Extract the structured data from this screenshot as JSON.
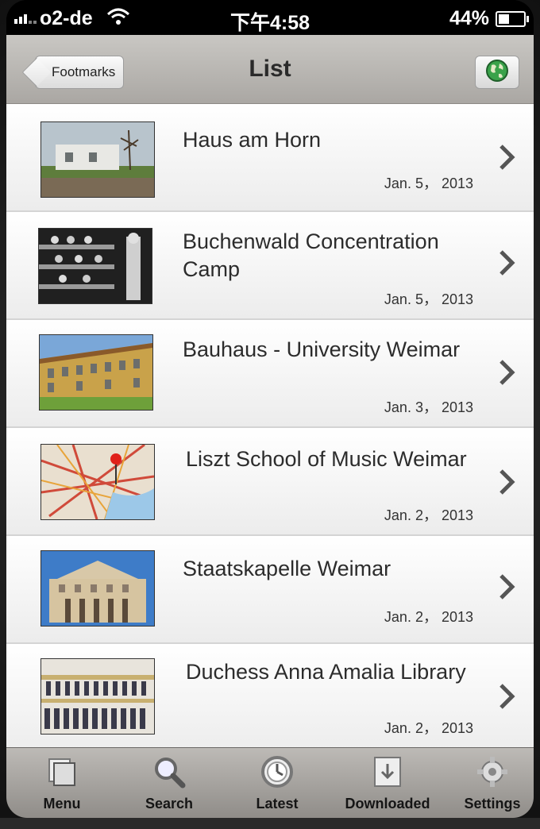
{
  "status_bar": {
    "carrier": "o2-de",
    "time": "下午4:58",
    "battery": "44%",
    "battery_level": 0.44
  },
  "navbar": {
    "back_label": "Footmarks",
    "title": "List",
    "right_icon": "globe-icon"
  },
  "list": {
    "items": [
      {
        "title": "Haus am Horn",
        "date": "Jan. 5， 2013",
        "thumb": "house"
      },
      {
        "title": "Buchenwald Concentration Camp",
        "date": "Jan. 5， 2013",
        "thumb": "camp"
      },
      {
        "title": "Bauhaus - University Weimar",
        "date": "Jan. 3， 2013",
        "thumb": "university"
      },
      {
        "title": "Liszt School of Music Weimar",
        "date": "Jan. 2， 2013",
        "thumb": "map-pin"
      },
      {
        "title": "Staatskapelle Weimar",
        "date": "Jan. 2， 2013",
        "thumb": "theater"
      },
      {
        "title": "Duchess Anna Amalia Library",
        "date": "Jan. 2， 2013",
        "thumb": "library"
      }
    ]
  },
  "tabbar": {
    "tabs": [
      {
        "label": "Menu",
        "icon": "menu-icon"
      },
      {
        "label": "Search",
        "icon": "search-icon"
      },
      {
        "label": "Latest",
        "icon": "clock-icon"
      },
      {
        "label": "Downloaded",
        "icon": "download-icon"
      },
      {
        "label": "Settings",
        "icon": "gear-icon"
      }
    ]
  }
}
